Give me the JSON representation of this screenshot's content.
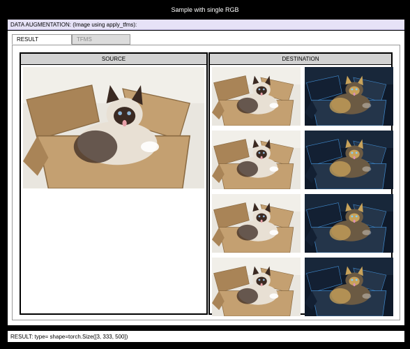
{
  "window": {
    "title": "Sample with single RGB"
  },
  "header": {
    "label": "DATA AUGMENTATION: (Image using apply_tfms):"
  },
  "tabs": [
    {
      "label": "RESULT",
      "active": true
    },
    {
      "label": "TFMS",
      "active": false
    }
  ],
  "source": {
    "title": "SOURCE",
    "image": {
      "subject": "cat sitting in cardboard box",
      "variant": "original"
    }
  },
  "destination": {
    "title": "DESTINATION",
    "images": [
      {
        "subject": "cat sitting in cardboard box",
        "variant": "original"
      },
      {
        "subject": "cat sitting in cardboard box",
        "variant": "dark-inverted"
      },
      {
        "subject": "cat sitting in cardboard box",
        "variant": "original"
      },
      {
        "subject": "cat sitting in cardboard box",
        "variant": "dark-inverted"
      },
      {
        "subject": "cat sitting in cardboard box",
        "variant": "original"
      },
      {
        "subject": "cat sitting in cardboard box",
        "variant": "dark-inverted"
      },
      {
        "subject": "cat sitting in cardboard box",
        "variant": "original"
      },
      {
        "subject": "cat sitting in cardboard box",
        "variant": "dark-inverted"
      }
    ]
  },
  "status": {
    "text": "RESULT: type= shape=torch.Size([3, 333, 500])"
  },
  "colors": {
    "header_bg": "#e6e2f7",
    "pane_header_bg": "#d2d2d2",
    "box": "#c4a071",
    "cat_fur": "#e8e0d4",
    "cat_dark": "#3b2a22",
    "inverted_bg": "#0f1a2a",
    "inverted_accent": "#3f87c9"
  }
}
